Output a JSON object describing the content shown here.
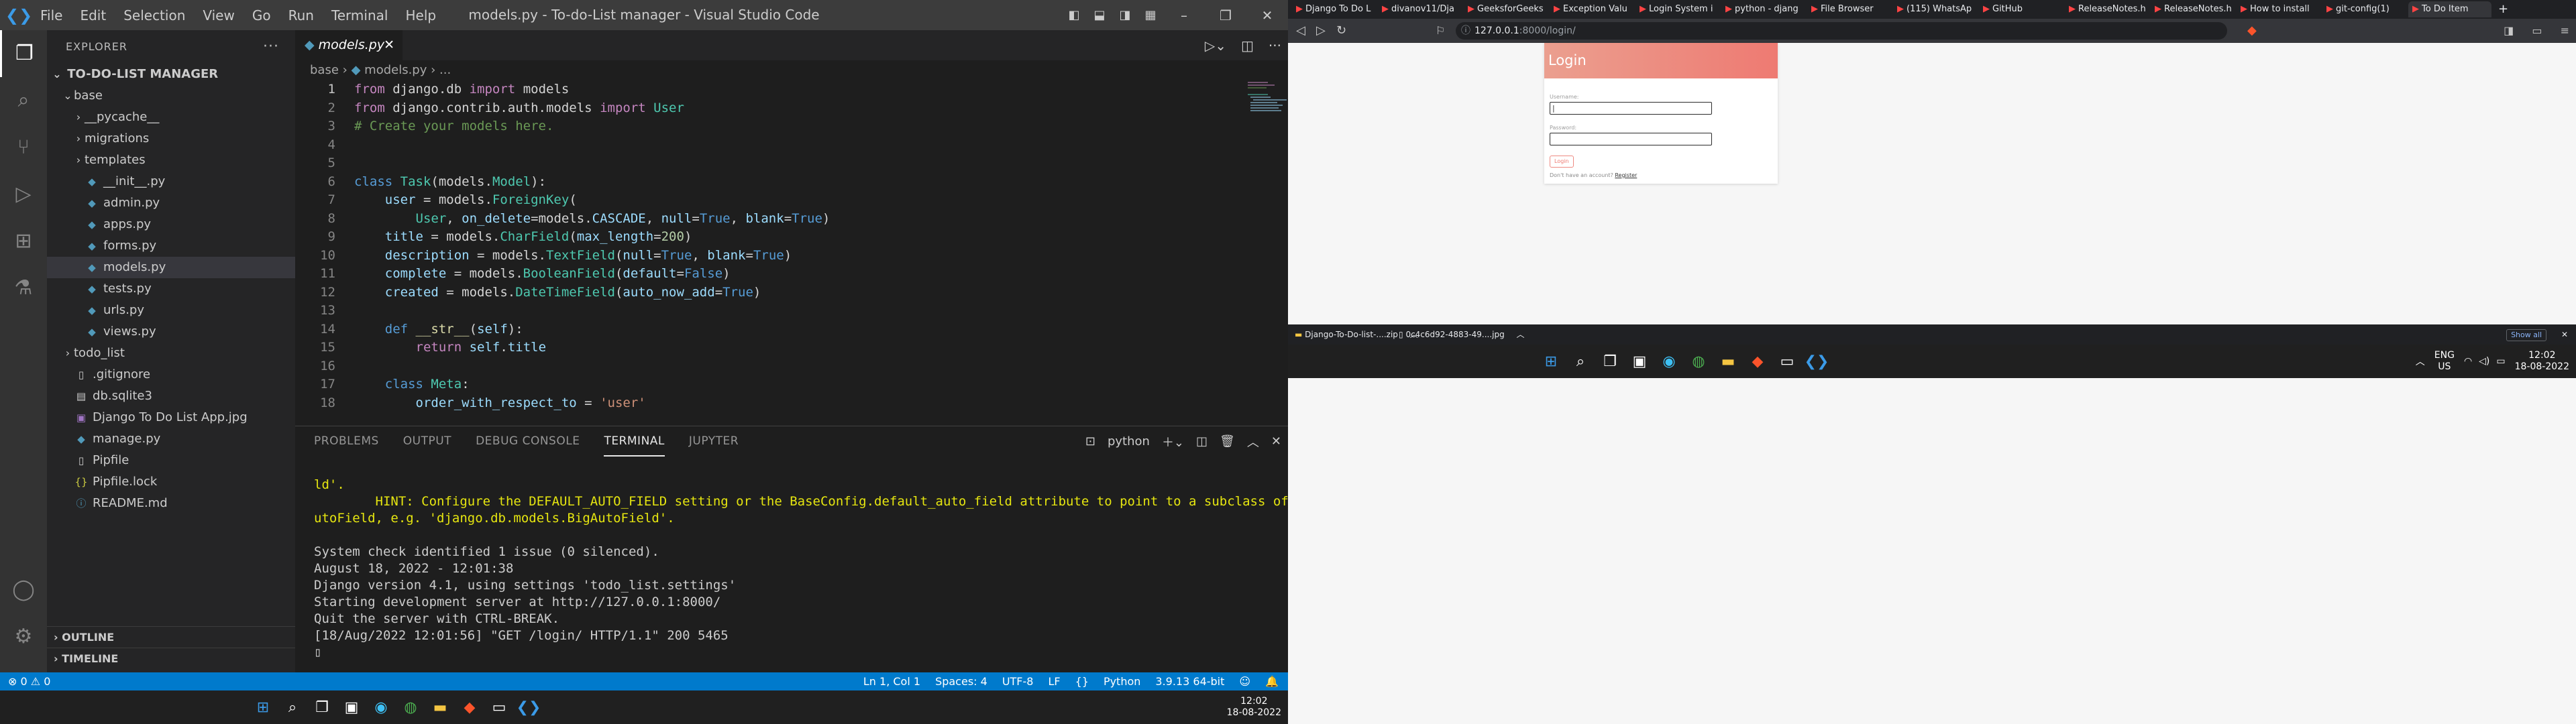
{
  "vscode": {
    "window_title": "models.py - To-do-List manager - Visual Studio Code",
    "menu": [
      "File",
      "Edit",
      "Selection",
      "View",
      "Go",
      "Run",
      "Terminal",
      "Help"
    ],
    "explorer_title": "EXPLORER",
    "project": "TO-DO-LIST MANAGER",
    "tree": [
      {
        "label": "base",
        "depth": 1,
        "type": "folder-open",
        "icon": "chevron-down-icon"
      },
      {
        "label": "__pycache__",
        "depth": 2,
        "type": "folder",
        "icon": "chevron-right-icon"
      },
      {
        "label": "migrations",
        "depth": 2,
        "type": "folder",
        "icon": "chevron-right-icon"
      },
      {
        "label": "templates",
        "depth": 2,
        "type": "folder",
        "icon": "chevron-right-icon"
      },
      {
        "label": "__init__.py",
        "depth": 2,
        "type": "py"
      },
      {
        "label": "admin.py",
        "depth": 2,
        "type": "py"
      },
      {
        "label": "apps.py",
        "depth": 2,
        "type": "py"
      },
      {
        "label": "forms.py",
        "depth": 2,
        "type": "py"
      },
      {
        "label": "models.py",
        "depth": 2,
        "type": "py",
        "selected": true
      },
      {
        "label": "tests.py",
        "depth": 2,
        "type": "py"
      },
      {
        "label": "urls.py",
        "depth": 2,
        "type": "py"
      },
      {
        "label": "views.py",
        "depth": 2,
        "type": "py"
      },
      {
        "label": "todo_list",
        "depth": 1,
        "type": "folder",
        "icon": "chevron-right-icon"
      },
      {
        "label": ".gitignore",
        "depth": 1,
        "type": "file"
      },
      {
        "label": "db.sqlite3",
        "depth": 1,
        "type": "db"
      },
      {
        "label": "Django To Do List App.jpg",
        "depth": 1,
        "type": "img"
      },
      {
        "label": "manage.py",
        "depth": 1,
        "type": "py"
      },
      {
        "label": "Pipfile",
        "depth": 1,
        "type": "file"
      },
      {
        "label": "Pipfile.lock",
        "depth": 1,
        "type": "json"
      },
      {
        "label": "README.md",
        "depth": 1,
        "type": "md"
      }
    ],
    "outline_label": "OUTLINE",
    "timeline_label": "TIMELINE",
    "tab_label": "models.py",
    "breadcrumb": [
      "base",
      "models.py",
      "..."
    ],
    "code_lines": [
      [
        [
          "kw",
          "from"
        ],
        [
          "pl",
          " django.db "
        ],
        [
          "kw",
          "import"
        ],
        [
          "pl",
          " models"
        ]
      ],
      [
        [
          "kw",
          "from"
        ],
        [
          "pl",
          " django.contrib.auth.models "
        ],
        [
          "kw",
          "import"
        ],
        [
          "pl",
          " "
        ],
        [
          "cls",
          "User"
        ]
      ],
      [
        [
          "cmt",
          "# Create your models here."
        ]
      ],
      [],
      [],
      [
        [
          "kw2",
          "class"
        ],
        [
          "pl",
          " "
        ],
        [
          "cls",
          "Task"
        ],
        [
          "pl",
          "(models."
        ],
        [
          "cls",
          "Model"
        ],
        [
          "pl",
          "):"
        ]
      ],
      [
        [
          "pl",
          "    "
        ],
        [
          "prm",
          "user"
        ],
        [
          "pl",
          " = models."
        ],
        [
          "cls",
          "ForeignKey"
        ],
        [
          "pl",
          "("
        ]
      ],
      [
        [
          "pl",
          "        "
        ],
        [
          "cls",
          "User"
        ],
        [
          "pl",
          ", "
        ],
        [
          "prm",
          "on_delete"
        ],
        [
          "pl",
          "=models."
        ],
        [
          "prm",
          "CASCADE"
        ],
        [
          "pl",
          ", "
        ],
        [
          "prm",
          "null"
        ],
        [
          "pl",
          "="
        ],
        [
          "kw2",
          "True"
        ],
        [
          "pl",
          ", "
        ],
        [
          "prm",
          "blank"
        ],
        [
          "pl",
          "="
        ],
        [
          "kw2",
          "True"
        ],
        [
          "pl",
          ")"
        ]
      ],
      [
        [
          "pl",
          "    "
        ],
        [
          "prm",
          "title"
        ],
        [
          "pl",
          " = models."
        ],
        [
          "cls",
          "CharField"
        ],
        [
          "pl",
          "("
        ],
        [
          "prm",
          "max_length"
        ],
        [
          "pl",
          "="
        ],
        [
          "num",
          "200"
        ],
        [
          "pl",
          ")"
        ]
      ],
      [
        [
          "pl",
          "    "
        ],
        [
          "prm",
          "description"
        ],
        [
          "pl",
          " = models."
        ],
        [
          "cls",
          "TextField"
        ],
        [
          "pl",
          "("
        ],
        [
          "prm",
          "null"
        ],
        [
          "pl",
          "="
        ],
        [
          "kw2",
          "True"
        ],
        [
          "pl",
          ", "
        ],
        [
          "prm",
          "blank"
        ],
        [
          "pl",
          "="
        ],
        [
          "kw2",
          "True"
        ],
        [
          "pl",
          ")"
        ]
      ],
      [
        [
          "pl",
          "    "
        ],
        [
          "prm",
          "complete"
        ],
        [
          "pl",
          " = models."
        ],
        [
          "cls",
          "BooleanField"
        ],
        [
          "pl",
          "("
        ],
        [
          "prm",
          "default"
        ],
        [
          "pl",
          "="
        ],
        [
          "kw2",
          "False"
        ],
        [
          "pl",
          ")"
        ]
      ],
      [
        [
          "pl",
          "    "
        ],
        [
          "prm",
          "created"
        ],
        [
          "pl",
          " = models."
        ],
        [
          "cls",
          "DateTimeField"
        ],
        [
          "pl",
          "("
        ],
        [
          "prm",
          "auto_now_add"
        ],
        [
          "pl",
          "="
        ],
        [
          "kw2",
          "True"
        ],
        [
          "pl",
          ")"
        ]
      ],
      [],
      [
        [
          "pl",
          "    "
        ],
        [
          "kw2",
          "def"
        ],
        [
          "pl",
          " "
        ],
        [
          "fn",
          "__str__"
        ],
        [
          "pl",
          "("
        ],
        [
          "prm",
          "self"
        ],
        [
          "pl",
          "):"
        ]
      ],
      [
        [
          "pl",
          "        "
        ],
        [
          "kw",
          "return"
        ],
        [
          "pl",
          " "
        ],
        [
          "prm",
          "self"
        ],
        [
          "pl",
          "."
        ],
        [
          "prm",
          "title"
        ]
      ],
      [],
      [
        [
          "pl",
          "    "
        ],
        [
          "kw2",
          "class"
        ],
        [
          "pl",
          " "
        ],
        [
          "cls",
          "Meta"
        ],
        [
          "pl",
          ":"
        ]
      ],
      [
        [
          "pl",
          "        "
        ],
        [
          "prm",
          "order_with_respect_to"
        ],
        [
          "pl",
          " = "
        ],
        [
          "str",
          "'user'"
        ]
      ]
    ],
    "panel_tabs": [
      "PROBLEMS",
      "OUTPUT",
      "DEBUG CONSOLE",
      "TERMINAL",
      "JUPYTER"
    ],
    "active_panel_tab": "TERMINAL",
    "terminal_shell": "python",
    "terminal_lines": [
      {
        "t": "ld'.",
        "c": "y"
      },
      {
        "t": "        HINT: Configure the DEFAULT_AUTO_FIELD setting or the BaseConfig.default_auto_field attribute to point to a subclass of A",
        "c": "y"
      },
      {
        "t": "utoField, e.g. 'django.db.models.BigAutoField'.",
        "c": "y"
      },
      {
        "t": "",
        "c": ""
      },
      {
        "t": "System check identified 1 issue (0 silenced).",
        "c": ""
      },
      {
        "t": "August 18, 2022 - 12:01:38",
        "c": ""
      },
      {
        "t": "Django version 4.1, using settings 'todo_list.settings'",
        "c": ""
      },
      {
        "t": "Starting development server at http://127.0.0.1:8000/",
        "c": ""
      },
      {
        "t": "Quit the server with CTRL-BREAK.",
        "c": ""
      },
      {
        "t": "[18/Aug/2022 12:01:56] \"GET /login/ HTTP/1.1\" 200 5465",
        "c": ""
      },
      {
        "t": "▯",
        "c": ""
      }
    ],
    "status": {
      "problems": "⊗ 0 ⚠ 0",
      "position": "Ln 1, Col 1",
      "spaces": "Spaces: 4",
      "encoding": "UTF-8",
      "eol": "LF",
      "language": "Python",
      "interpreter": "3.9.13 64-bit"
    }
  },
  "taskbar": {
    "date": "18-08-2022",
    "time": "12:02",
    "lang": "ENG",
    "region": "US"
  },
  "browser": {
    "tabs": [
      "Django To Do L",
      "divanov11/Dja",
      "GeeksforGeeks",
      "Exception Valu",
      "Login System i",
      "python - djang",
      "File Browser",
      "(115) WhatsAp",
      "GitHub",
      "ReleaseNotes.h",
      "ReleaseNotes.h",
      "How to install",
      "git-config(1)",
      "To Do Item"
    ],
    "url_host": "127.0.0.1",
    "url_path": ":8000/login/",
    "login": {
      "title": "Login",
      "username_label": "Username:",
      "password_label": "Password:",
      "button": "Login",
      "no_account": "Don't have an account?",
      "register": "Register"
    },
    "downloads": [
      "Django-To-Do-list-....zip",
      "0c4c6d92-4883-49....jpg"
    ],
    "show_all": "Show all"
  }
}
